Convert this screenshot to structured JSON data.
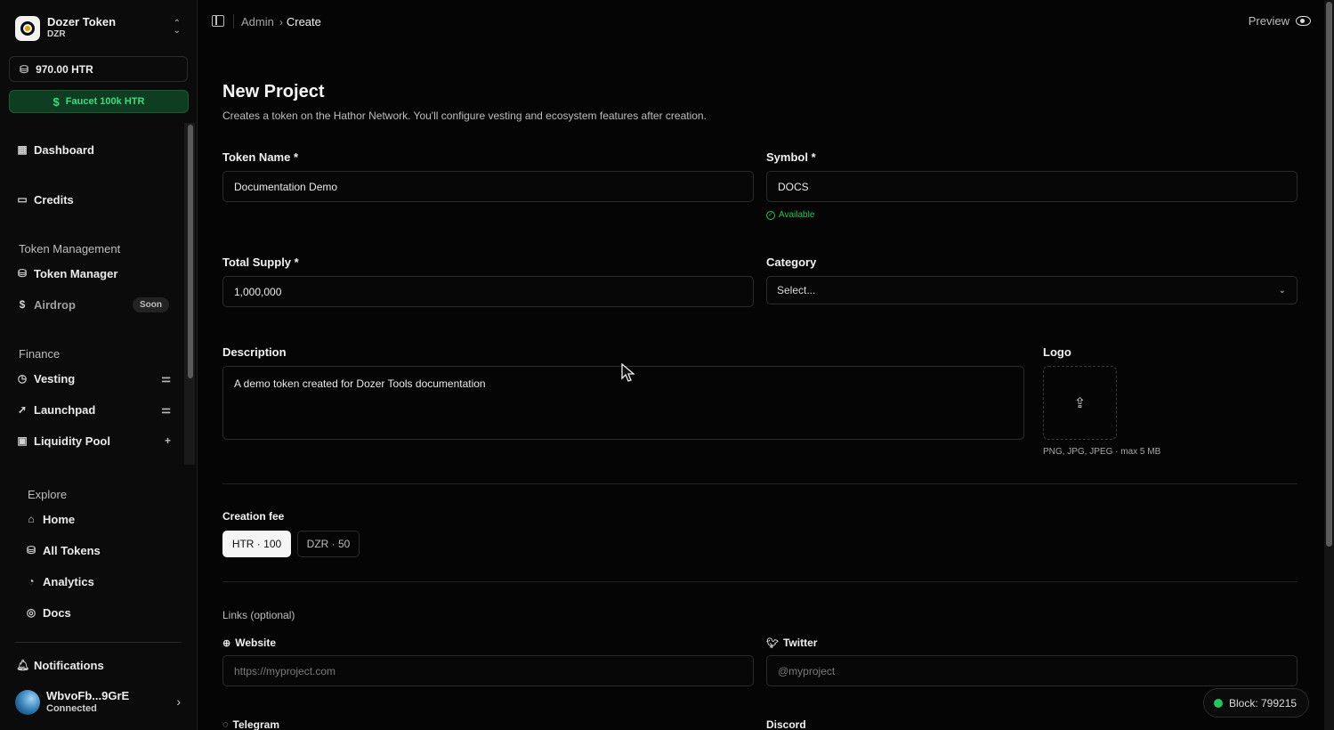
{
  "brand": {
    "name": "Dozer Token",
    "symbol": "DZR"
  },
  "wallet": {
    "balance": "970.00 HTR",
    "faucet": "Faucet 100k HTR"
  },
  "nav": {
    "dashboard": "Dashboard",
    "credits": "Credits",
    "token_mgmt_section": "Token Management",
    "token_manager": "Token Manager",
    "airdrop": "Airdrop",
    "soon": "Soon",
    "finance_section": "Finance",
    "vesting": "Vesting",
    "launchpad": "Launchpad",
    "liquidity_pool": "Liquidity Pool",
    "explore_section": "Explore",
    "home": "Home",
    "all_tokens": "All Tokens",
    "analytics": "Analytics",
    "docs": "Docs",
    "notifications": "Notifications"
  },
  "user": {
    "address": "WbvoFb...9GrE",
    "status": "Connected"
  },
  "breadcrumb": {
    "admin": "Admin",
    "current": "Create"
  },
  "preview": "Preview",
  "page": {
    "title": "New Project",
    "subtitle": "Creates a token on the Hathor Network. You'll configure vesting and ecosystem features after creation."
  },
  "form": {
    "token_name_label": "Token Name *",
    "token_name_value": "Documentation Demo",
    "symbol_label": "Symbol *",
    "symbol_value": "DOCS",
    "symbol_status": "Available",
    "supply_label": "Total Supply *",
    "supply_value": "1,000,000",
    "category_label": "Category",
    "category_value": "Select...",
    "description_label": "Description",
    "description_value": "A demo token created for Dozer Tools documentation",
    "logo_label": "Logo",
    "logo_hint": "PNG, JPG, JPEG · max 5 MB",
    "fee_label": "Creation fee",
    "fee_options": [
      "HTR · 100",
      "DZR · 50"
    ],
    "links_label": "Links (optional)",
    "website_label": "Website",
    "website_placeholder": "https://myproject.com",
    "twitter_label": "Twitter",
    "twitter_placeholder": "@myproject",
    "telegram_label": "Telegram",
    "discord_label": "Discord"
  },
  "status": {
    "block": "Block: 799215"
  },
  "colors": {
    "accent_green": "#22c55e",
    "faucet_bg": "#0f3d22",
    "background": "#050505"
  }
}
